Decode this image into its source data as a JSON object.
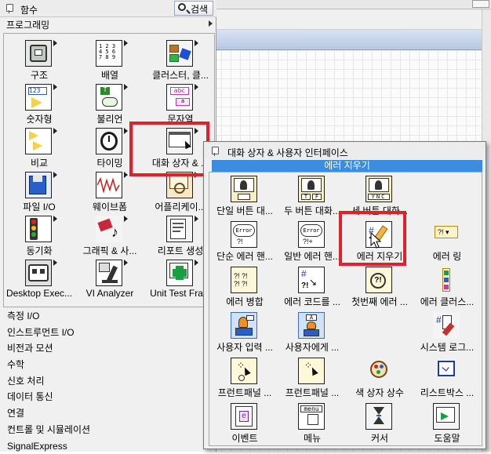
{
  "palette": {
    "title": "함수",
    "search_label": "검색",
    "category": "프로그래밍",
    "icons": [
      {
        "label": "구조",
        "icon": "structures-icon"
      },
      {
        "label": "배열",
        "icon": "array-icon"
      },
      {
        "label": "클러스터, 클...",
        "icon": "cluster-icon"
      },
      {
        "label": "숫자형",
        "icon": "numeric-icon"
      },
      {
        "label": "불리언",
        "icon": "boolean-icon"
      },
      {
        "label": "문자열",
        "icon": "string-icon"
      },
      {
        "label": "비교",
        "icon": "comparison-icon"
      },
      {
        "label": "타이밍",
        "icon": "timing-icon"
      },
      {
        "label": "대화 상자 & ...",
        "icon": "dialog-ui-icon"
      },
      {
        "label": "파일 I/O",
        "icon": "file-io-icon"
      },
      {
        "label": "웨이브폼",
        "icon": "waveform-icon"
      },
      {
        "label": "어플리케이...",
        "icon": "app-control-icon"
      },
      {
        "label": "동기화",
        "icon": "synchronization-icon"
      },
      {
        "label": "그래픽 & 사...",
        "icon": "graphics-sound-icon"
      },
      {
        "label": "리포트 생성",
        "icon": "report-icon"
      },
      {
        "label": "Desktop Exec...",
        "icon": "desktop-exec-icon"
      },
      {
        "label": "VI Analyzer",
        "icon": "vi-analyzer-icon"
      },
      {
        "label": "Unit Test Fra...",
        "icon": "unit-test-icon"
      }
    ],
    "categories": [
      "측정 I/O",
      "인스트루먼트 I/O",
      "비전과 모션",
      "수학",
      "신호 처리",
      "데이터 통신",
      "연결",
      "컨트롤 및 시뮬레이션",
      "SignalExpress"
    ]
  },
  "subpalette": {
    "title": "대화 상자 & 사용자 인터페이스",
    "tooltip": "에러 지우기",
    "icons": [
      {
        "label": "단일 버튼 대...",
        "icon": "one-button-dialog-icon"
      },
      {
        "label": "두 버튼 대화...",
        "icon": "two-button-dialog-icon"
      },
      {
        "label": "세 버튼 대화...",
        "icon": "three-button-dialog-icon"
      },
      {
        "label": "",
        "icon": ""
      },
      {
        "label": "단순 에러 핸...",
        "icon": "simple-error-handler-icon"
      },
      {
        "label": "일반 에러 핸...",
        "icon": "general-error-handler-icon"
      },
      {
        "label": "에러 지우기",
        "icon": "clear-errors-icon"
      },
      {
        "label": "에러 링",
        "icon": "error-ring-icon"
      },
      {
        "label": "에러 병합",
        "icon": "merge-errors-icon"
      },
      {
        "label": "에러 코드를 ...",
        "icon": "error-code-to-cluster-icon"
      },
      {
        "label": "첫번째 에러 ...",
        "icon": "first-error-icon"
      },
      {
        "label": "에러 클러스...",
        "icon": "error-cluster-constant-icon"
      },
      {
        "label": "사용자 입력 ...",
        "icon": "prompt-user-input-icon"
      },
      {
        "label": "사용자에게 ...",
        "icon": "display-message-icon"
      },
      {
        "label": "",
        "icon": ""
      },
      {
        "label": "시스템 로그...",
        "icon": "system-login-icon"
      },
      {
        "label": "프런트패널 ...",
        "icon": "fp-event-icon-a"
      },
      {
        "label": "프런트패널 ...",
        "icon": "fp-event-icon-b"
      },
      {
        "label": "색 상자 상수",
        "icon": "color-box-constant-icon"
      },
      {
        "label": "리스트박스 ...",
        "icon": "listbox-icon"
      },
      {
        "label": "이벤트",
        "icon": "events-icon"
      },
      {
        "label": "메뉴",
        "icon": "menu-icon"
      },
      {
        "label": "커서",
        "icon": "cursor-icon"
      },
      {
        "label": "도움말",
        "icon": "help-icon"
      }
    ]
  }
}
